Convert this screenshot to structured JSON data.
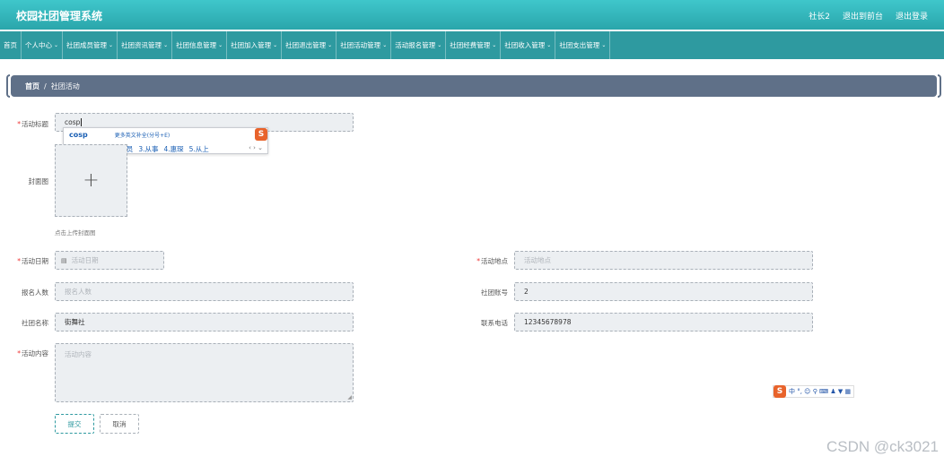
{
  "header": {
    "brand": "校园社团管理系统",
    "user": "社长2",
    "back_to_admin": "退出到前台",
    "logout": "退出登录"
  },
  "nav": {
    "items": [
      {
        "label": "首页",
        "dropdown": false
      },
      {
        "label": "个人中心",
        "dropdown": true
      },
      {
        "label": "社团成员管理",
        "dropdown": true
      },
      {
        "label": "社团资讯管理",
        "dropdown": true
      },
      {
        "label": "社团信息管理",
        "dropdown": true
      },
      {
        "label": "社团加入管理",
        "dropdown": true
      },
      {
        "label": "社团退出管理",
        "dropdown": true
      },
      {
        "label": "社团活动管理",
        "dropdown": true
      },
      {
        "label": "活动报名管理",
        "dropdown": true
      },
      {
        "label": "社团经费管理",
        "dropdown": true
      },
      {
        "label": "社团收入管理",
        "dropdown": true
      },
      {
        "label": "社团支出管理",
        "dropdown": true
      }
    ]
  },
  "breadcrumb": {
    "home": "首页",
    "separator": "/",
    "current": "社团活动"
  },
  "form": {
    "title_label": "活动标题",
    "title_value": "cosp",
    "cover_label": "封面图",
    "cover_hint": "点击上传封面图",
    "date_label": "活动日期",
    "date_placeholder": "活动日期",
    "location_label": "活动地点",
    "location_placeholder": "活动地点",
    "count_label": "报名人数",
    "count_placeholder": "报名人数",
    "club_account_label": "社团账号",
    "club_account_value": "2",
    "club_name_label": "社团名称",
    "club_name_value": "街舞社",
    "phone_label": "联系电话",
    "phone_value": "12345678978",
    "content_label": "活动内容",
    "content_placeholder": "活动内容",
    "submit": "提交",
    "cancel": "取消"
  },
  "ime": {
    "pinyin": "cosp",
    "tip": "更多英文补全(分号+E)",
    "candidates": [
      "1.cosplay",
      "2.从商员",
      "3.从事",
      "4.惠琛",
      "5.从上"
    ],
    "pager": "‹ › ⌄",
    "toolbar": "中 °, ☺ ⚲ ⌨ ♟ ▼ ▦"
  },
  "watermark": "CSDN @ck3021",
  "colors": {
    "header": "#2aa6ab",
    "nav": "#2e9aa0",
    "breadcrumb": "#5f7088",
    "required": "#e33333"
  }
}
